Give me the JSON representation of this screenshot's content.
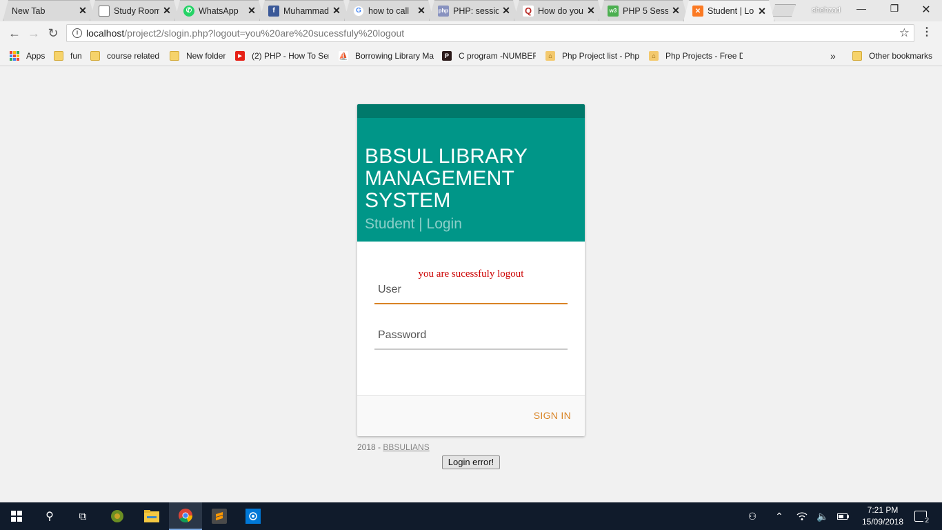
{
  "browser": {
    "tabs": [
      {
        "label": "New Tab",
        "icon": "blank",
        "active": false
      },
      {
        "label": "Study Room",
        "icon": "page-icon",
        "active": false
      },
      {
        "label": "WhatsApp",
        "icon": "whatsapp-icon",
        "active": false
      },
      {
        "label": "Muhammad",
        "icon": "facebook-icon",
        "active": false
      },
      {
        "label": "how to call",
        "icon": "google-icon",
        "active": false
      },
      {
        "label": "PHP: session",
        "icon": "php-icon",
        "active": false
      },
      {
        "label": "How do you",
        "icon": "quora-icon",
        "active": false
      },
      {
        "label": "PHP 5 Sessi",
        "icon": "w3schools-icon",
        "active": false
      },
      {
        "label": "Student | Lo",
        "icon": "xampp-icon",
        "active": true
      }
    ],
    "profile_name": "shehzad",
    "url_host": "localhost",
    "url_path": "/project2/slogin.php?logout=you%20are%20sucessfuly%20logout",
    "bookmarks": [
      {
        "label": "Apps",
        "icon": "apps-grid-icon"
      },
      {
        "label": "fun",
        "icon": "folder-icon"
      },
      {
        "label": "course related",
        "icon": "folder-icon"
      },
      {
        "label": "New folder",
        "icon": "folder-icon"
      },
      {
        "label": "(2) PHP - How To Sen",
        "icon": "youtube-icon"
      },
      {
        "label": "Borrowing Library Ma",
        "icon": "library-icon"
      },
      {
        "label": "C program -NUMBER",
        "icon": "p-icon"
      },
      {
        "label": "Php Project list - Php",
        "icon": "bookmark-icon"
      },
      {
        "label": "Php Projects - Free D",
        "icon": "bookmark-icon"
      }
    ],
    "overflow_label": "»",
    "other_bookmarks": "Other bookmarks"
  },
  "page": {
    "title_line1": "BBSUL LIBRARY",
    "title_line2": "MANAGEMENT",
    "title_line3": "SYSTEM",
    "subtitle": "Student | Login",
    "message": "you are sucessfuly logout",
    "user_placeholder": "User",
    "password_placeholder": "Password",
    "signin_label": "SIGN IN",
    "footer_year": "2018 - ",
    "footer_link": "BBSULIANS",
    "error_button": "Login error!"
  },
  "taskbar": {
    "time": "7:21 PM",
    "date": "15/09/2018",
    "notifications": "2"
  },
  "colors": {
    "header_teal": "#009688",
    "header_dark_teal": "#00796b",
    "accent_orange": "#d98324",
    "message_red": "#cc0000"
  }
}
